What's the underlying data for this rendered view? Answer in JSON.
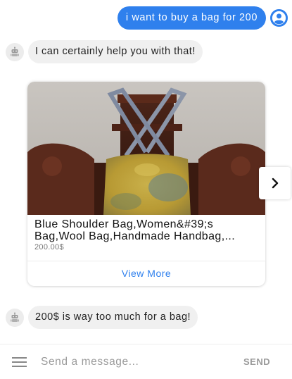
{
  "messages": {
    "user_1": "i want to buy a bag for 200",
    "bot_1": "I can certainly help you with that!",
    "bot_2": "200$ is way too much for a bag!"
  },
  "product_card": {
    "title": "Blue Shoulder Bag,Women&#39;s Bag,Wool Bag,Handmade Handbag,...",
    "price": "200.00$",
    "view_more_label": "View More"
  },
  "composer": {
    "placeholder": "Send a message...",
    "send_label": "SEND"
  },
  "icons": {
    "user_avatar": "user-circle-icon",
    "bot_avatar": "robot-icon",
    "next": "chevron-right-icon",
    "menu": "hamburger-menu-icon"
  },
  "colors": {
    "accent": "#2f80ed",
    "bot_bubble": "#f0f0f0",
    "muted_text": "#9a9a9a"
  }
}
